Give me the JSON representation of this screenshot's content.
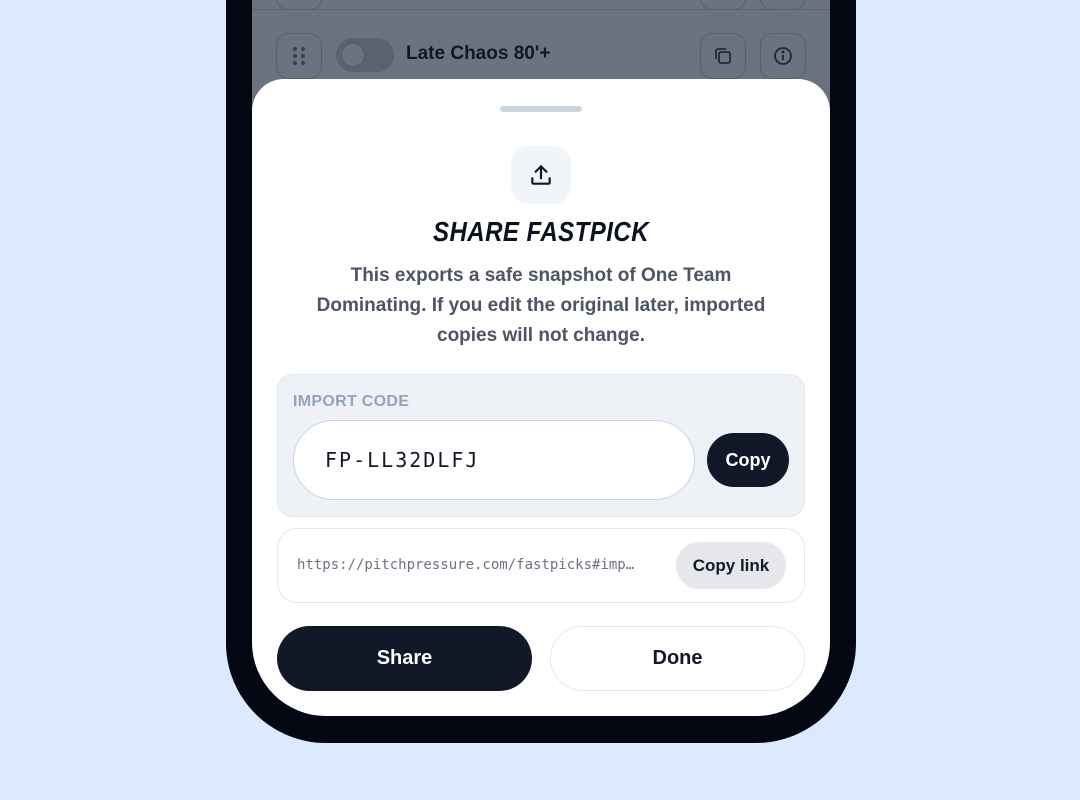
{
  "background_list": {
    "row_label": "Late Chaos 80'+",
    "icons": [
      "drag-handle-icon",
      "copy-icon",
      "info-icon"
    ]
  },
  "sheet": {
    "title": "SHARE FASTPICK",
    "description": "This exports a safe snapshot of One Team Dominating. If you edit the original later, imported copies will not change.",
    "import_code": {
      "label": "IMPORT CODE",
      "value": "FP-LL32DLFJ",
      "copy_label": "Copy"
    },
    "link": {
      "url": "https://pitchpressure.com/fastpicks#imp…",
      "copy_label": "Copy link"
    },
    "actions": {
      "share_label": "Share",
      "done_label": "Done"
    }
  },
  "colors": {
    "page_background": "#dbeafe",
    "accent_dark": "#111827",
    "muted_label": "#94a3b8"
  }
}
